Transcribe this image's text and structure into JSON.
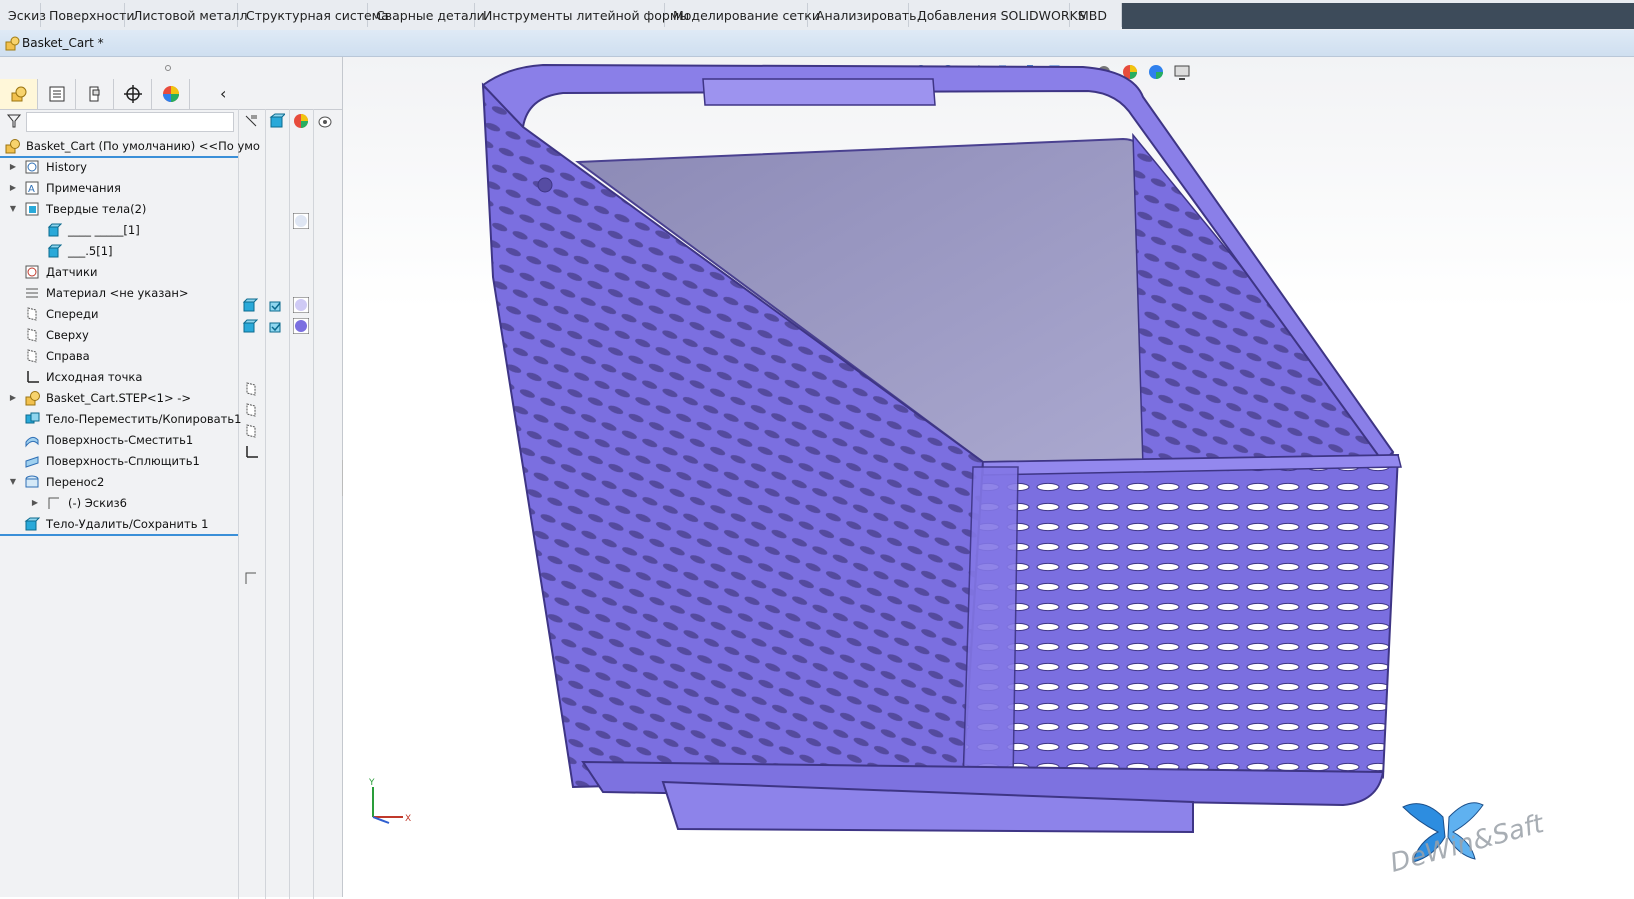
{
  "command_tabs": [
    "Эскиз",
    "Поверхности",
    "Листовой металл",
    "Структурная система",
    "Сварные детали",
    "Инструменты литейной формы",
    "Моделирование сетки",
    "Анализировать",
    "Добавления SOLIDWORKS",
    "MBD"
  ],
  "document": {
    "title": "Basket_Cart *"
  },
  "feature_manager": {
    "tabs": [
      "feature-manager-tab",
      "property-manager-tab",
      "configuration-manager-tab",
      "dimxpert-tab",
      "display-manager-tab"
    ],
    "tree": [
      {
        "label": "Basket_Cart  (По умолчанию) <<По умо"
      },
      {
        "label": "History"
      },
      {
        "label": "Примечания"
      },
      {
        "label": "Твердые тела(2)"
      },
      {
        "label": "____ _____[1]"
      },
      {
        "label": "___.5[1]"
      },
      {
        "label": "Датчики"
      },
      {
        "label": "Материал <не указан>"
      },
      {
        "label": "Спереди"
      },
      {
        "label": "Сверху"
      },
      {
        "label": "Справа"
      },
      {
        "label": "Исходная точка"
      },
      {
        "label": "Basket_Cart.STEP<1> ->"
      },
      {
        "label": "Тело-Переместить/Копировать1"
      },
      {
        "label": "Поверхность-Сместить1"
      },
      {
        "label": "Поверхность-Сплющить1"
      },
      {
        "label": "Перенос2"
      },
      {
        "label": "(-) Эскиз6"
      },
      {
        "label": "Тело-Удалить/Сохранить 1"
      }
    ]
  },
  "viewport": {
    "model_color": "#7b6fe0",
    "triad_labels": {
      "y": "Y",
      "x": "X"
    }
  },
  "watermark": {
    "text": "DeWin&Saft"
  }
}
